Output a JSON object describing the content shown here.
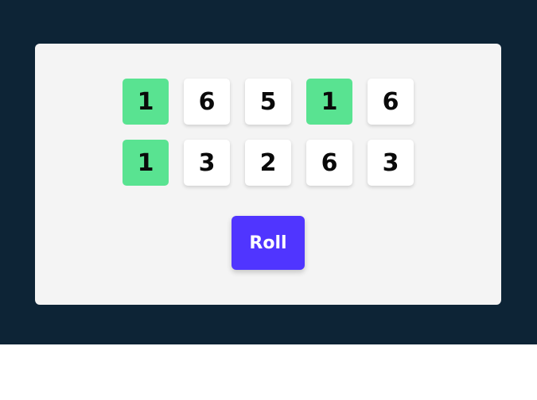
{
  "colors": {
    "backdrop": "#0d2436",
    "board": "#f4f4f4",
    "die": "#ffffff",
    "die_held": "#59e391",
    "roll_button": "#5035ff"
  },
  "dice": [
    {
      "value": "1",
      "held": true
    },
    {
      "value": "6",
      "held": false
    },
    {
      "value": "5",
      "held": false
    },
    {
      "value": "1",
      "held": true
    },
    {
      "value": "6",
      "held": false
    },
    {
      "value": "1",
      "held": true
    },
    {
      "value": "3",
      "held": false
    },
    {
      "value": "2",
      "held": false
    },
    {
      "value": "6",
      "held": false
    },
    {
      "value": "3",
      "held": false
    }
  ],
  "controls": {
    "roll_label": "Roll"
  }
}
